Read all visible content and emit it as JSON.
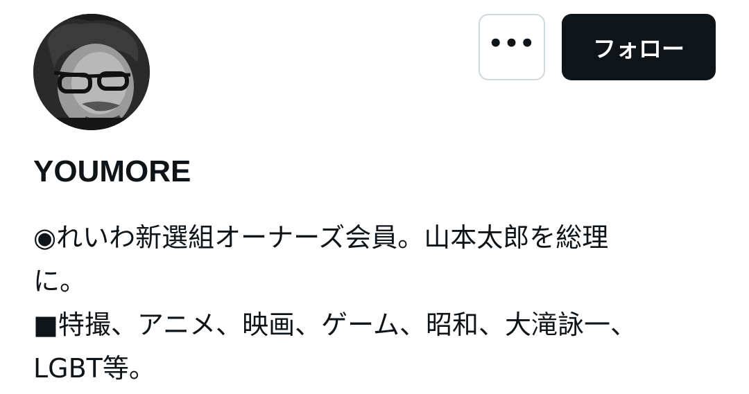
{
  "profile": {
    "display_name": "YOUMORE",
    "bio_lines": [
      "◉れいわ新選組オーナーズ会員。山本太郎を総理",
      "に。",
      "■特撮、アニメ、映画、ゲーム、昭和、大滝詠一、",
      "LGBT等。"
    ]
  },
  "actions": {
    "more_label": "•••",
    "follow_label": "フォロー"
  },
  "icons": {
    "more": "more-horizontal-icon"
  },
  "colors": {
    "text": "#0f1419",
    "follow_bg": "#0f1419",
    "follow_text": "#ffffff",
    "border": "#cfd9de"
  }
}
